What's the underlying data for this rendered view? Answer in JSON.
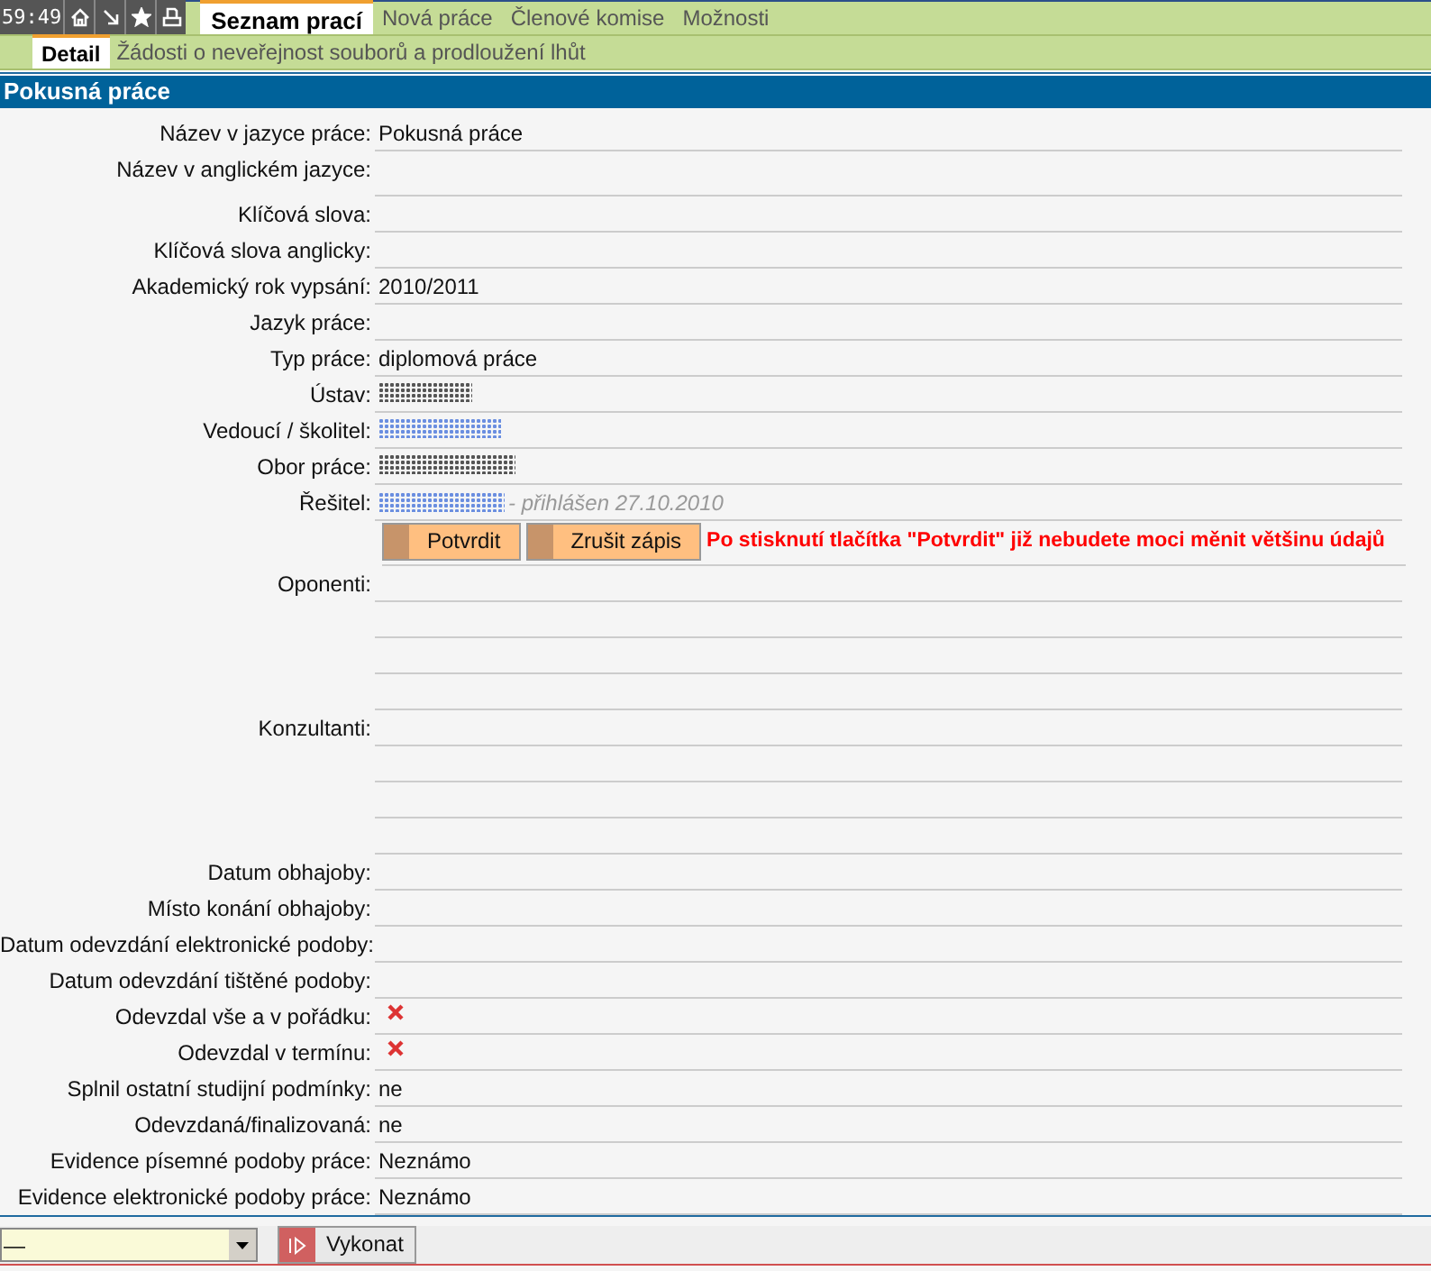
{
  "top_bar": {
    "clock": "59:49",
    "tabs": [
      {
        "label": "Seznam prací",
        "selected": true
      },
      {
        "label": "Nová práce",
        "selected": false
      },
      {
        "label": "Členové komise",
        "selected": false
      },
      {
        "label": "Možnosti",
        "selected": false
      }
    ]
  },
  "sub_tabs": [
    {
      "label": "Detail",
      "selected": true
    },
    {
      "label": "Žádosti o neveřejnost souborů a prodloužení lhůt",
      "selected": false
    }
  ],
  "section_title": "Pokusná práce",
  "fields": [
    {
      "label": "Název v jazyce práce:",
      "kind": "text",
      "value": "Pokusná práce"
    },
    {
      "label": "Název v anglickém jazyce:",
      "kind": "tall"
    },
    {
      "label": "Klíčová slova:",
      "kind": "text"
    },
    {
      "label": "Klíčová slova anglicky:",
      "kind": "text"
    },
    {
      "label": "Akademický rok vypsání:",
      "kind": "text",
      "value": "2010/2011"
    },
    {
      "label": "Jazyk práce:",
      "kind": "text"
    },
    {
      "label": "Typ práce:",
      "kind": "text",
      "value": "diplomová práce"
    },
    {
      "label": "Ústav:",
      "kind": "redacted"
    },
    {
      "label": "Vedoucí / školitel:",
      "kind": "redacted_link"
    },
    {
      "label": "Obor práce:",
      "kind": "redacted"
    },
    {
      "label": "Řešitel:",
      "kind": "signer",
      "note": "- přihlášen 27.10.2010"
    },
    {
      "kind": "actions",
      "buttons": [
        "Potvrdit",
        "Zrušit zápis"
      ],
      "warning": "Po stisknutí tlačítka \"Potvrdit\" již nebudete moci měnit většinu údajů"
    },
    {
      "label": "Oponenti:",
      "kind": "list"
    },
    {
      "label": "Konzultanti:",
      "kind": "list"
    },
    {
      "label": "Datum obhajoby:",
      "kind": "text"
    },
    {
      "label": "Místo konání obhajoby:",
      "kind": "text"
    },
    {
      "label": "Datum odevzdání elektronické podoby:",
      "kind": "text"
    },
    {
      "label": "Datum odevzdání tištěné podoby:",
      "kind": "text"
    },
    {
      "label": "Odevzdal vše a v pořádku:",
      "kind": "cross"
    },
    {
      "label": "Odevzdal v termínu:",
      "kind": "cross"
    },
    {
      "label": "Splnil ostatní studijní podmínky:",
      "kind": "text",
      "value": "ne"
    },
    {
      "label": "Odevzdaná/finalizovaná:",
      "kind": "text",
      "value": "ne"
    },
    {
      "label": "Evidence písemné podoby práce:",
      "kind": "text",
      "value": "Neznámo"
    },
    {
      "label": "Evidence elektronické podoby práce:",
      "kind": "text",
      "value": "Neznámo"
    }
  ],
  "footer": {
    "action_select": {
      "value": "—"
    },
    "button": "Vykonat"
  }
}
